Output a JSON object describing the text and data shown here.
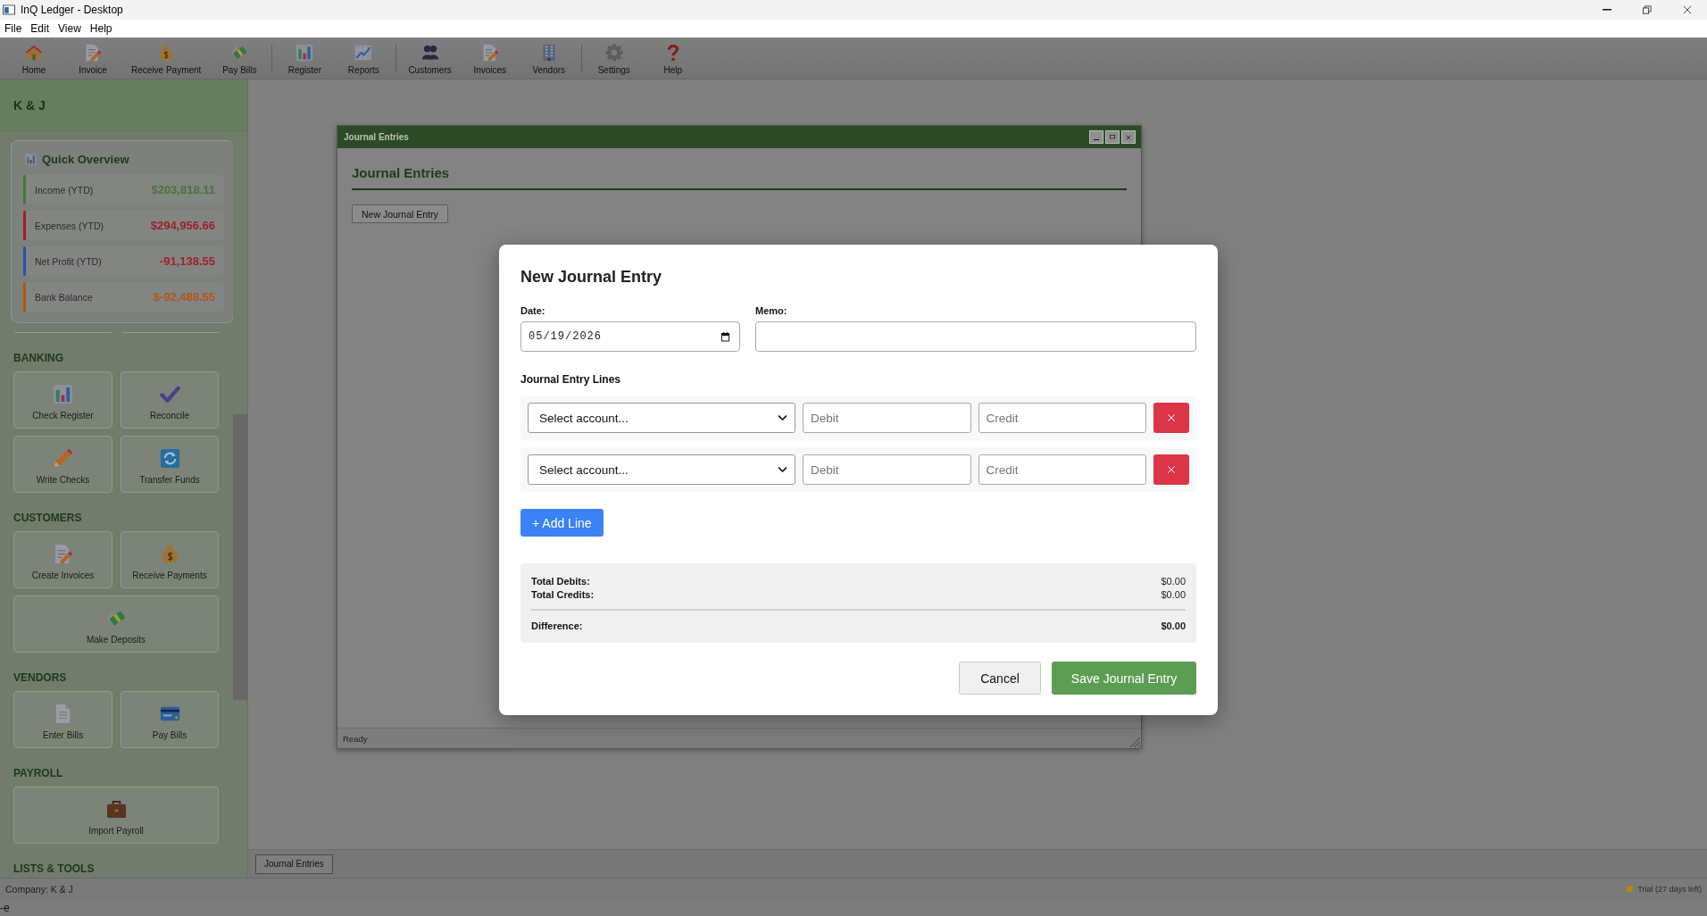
{
  "window": {
    "title": "InQ Ledger - Desktop"
  },
  "menu_bar": [
    "File",
    "Edit",
    "View",
    "Help"
  ],
  "toolbar": [
    [
      "Home",
      "Invoice",
      "Receive Payment",
      "Pay Bills"
    ],
    [
      "Register",
      "Reports"
    ],
    [
      "Customers",
      "Invoices",
      "Vendors"
    ],
    [
      "Settings",
      "Help"
    ]
  ],
  "sidebar": {
    "company": "K & J",
    "quick_overview": {
      "title": "Quick Overview",
      "items": [
        {
          "label": "Income (YTD)",
          "value": {
            "text": "$203,818.11",
            "color": "#47763a"
          },
          "color": "#3f7a35"
        },
        {
          "label": "Expenses (YTD)",
          "value": {
            "text": "$294,956.66",
            "color": "#9c2229"
          },
          "color": "#9a1f2b"
        },
        {
          "label": "Net Profit (YTD)",
          "value": {
            "text": "-91,138.55",
            "color": "#9c2229"
          },
          "color": "#1f55b0"
        },
        {
          "label": "Bank Balance",
          "value": {
            "text": "$-92,488.55",
            "color": "#b0571c"
          },
          "color": "#b0570f"
        }
      ]
    },
    "sections": [
      {
        "title": "BANKING",
        "tiles": [
          "Check Register",
          "Reconcile",
          "Write Checks",
          "Transfer Funds"
        ]
      },
      {
        "title": "CUSTOMERS",
        "tiles": [
          "Create Invoices",
          "Receive Payments",
          "Make Deposits"
        ]
      },
      {
        "title": "VENDORS",
        "tiles": [
          "Enter Bills",
          "Pay Bills"
        ]
      },
      {
        "title": "PAYROLL",
        "tiles": [
          "Import Payroll"
        ]
      },
      {
        "title": "LISTS & TOOLS"
      }
    ]
  },
  "journal_window": {
    "title": "Journal Entries",
    "heading": "Journal Entries",
    "new_button": "New Journal Entry",
    "status": "Ready"
  },
  "taskbar": [
    "Journal Entries"
  ],
  "dialog": {
    "title": "New Journal Entry",
    "date": {
      "label": "Date:",
      "value": "05/19/2026"
    },
    "memo": {
      "label": "Memo:"
    },
    "lines_title": "Journal Entry Lines",
    "lines": [
      {
        "account": "Select account...",
        "debit_placeholder": "Debit",
        "credit_placeholder": "Credit"
      },
      {
        "account": "Select account...",
        "debit_placeholder": "Debit",
        "credit_placeholder": "Credit"
      }
    ],
    "add_line": "+ Add Line",
    "totals": [
      {
        "label": "Total Debits:",
        "value": "$0.00"
      },
      {
        "label": "Total Credits:",
        "value": "$0.00"
      }
    ],
    "difference": {
      "label": "Difference:",
      "value": "$0.00"
    },
    "buttons": {
      "cancel": "Cancel",
      "save": "Save Journal Entry"
    }
  },
  "status_bar": {
    "company": "Company: K & J",
    "trial": "Trial (27 days left)"
  },
  "console_line": "-e"
}
